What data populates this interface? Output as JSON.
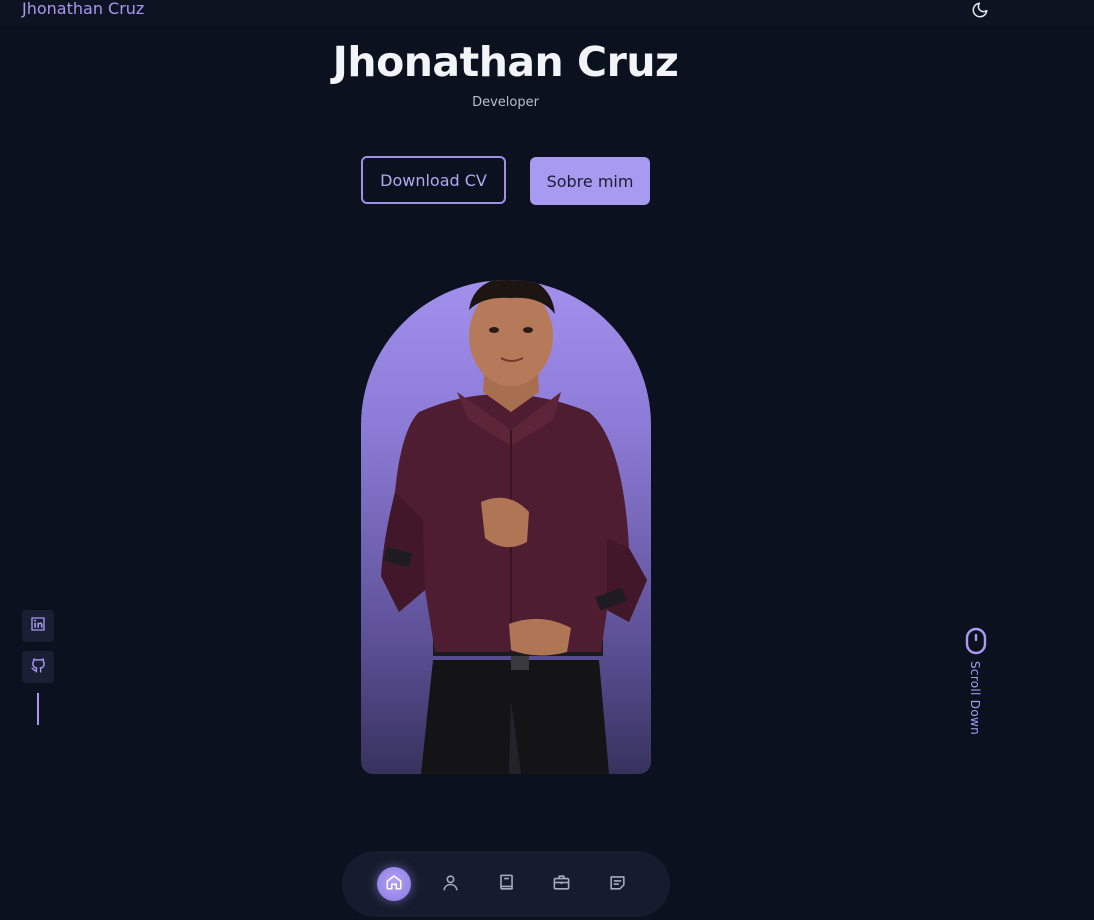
{
  "header": {
    "logo": "Jhonathan Cruz",
    "theme_icon": "moon-icon"
  },
  "hero": {
    "name": "Jhonathan Cruz",
    "role": "Developer",
    "download_cv_label": "Download CV",
    "about_label": "Sobre mim"
  },
  "socials": {
    "items": [
      {
        "icon": "linkedin-icon"
      },
      {
        "icon": "github-icon"
      }
    ]
  },
  "scroll": {
    "label": "Scroll Down",
    "icon": "mouse-icon"
  },
  "nav": {
    "items": [
      {
        "icon": "home-icon",
        "active": true
      },
      {
        "icon": "user-icon",
        "active": false
      },
      {
        "icon": "book-icon",
        "active": false
      },
      {
        "icon": "briefcase-icon",
        "active": false
      },
      {
        "icon": "message-icon",
        "active": false
      }
    ]
  },
  "colors": {
    "background": "#0c1120",
    "accent": "#a897f0",
    "text": "#f3f4f8"
  }
}
